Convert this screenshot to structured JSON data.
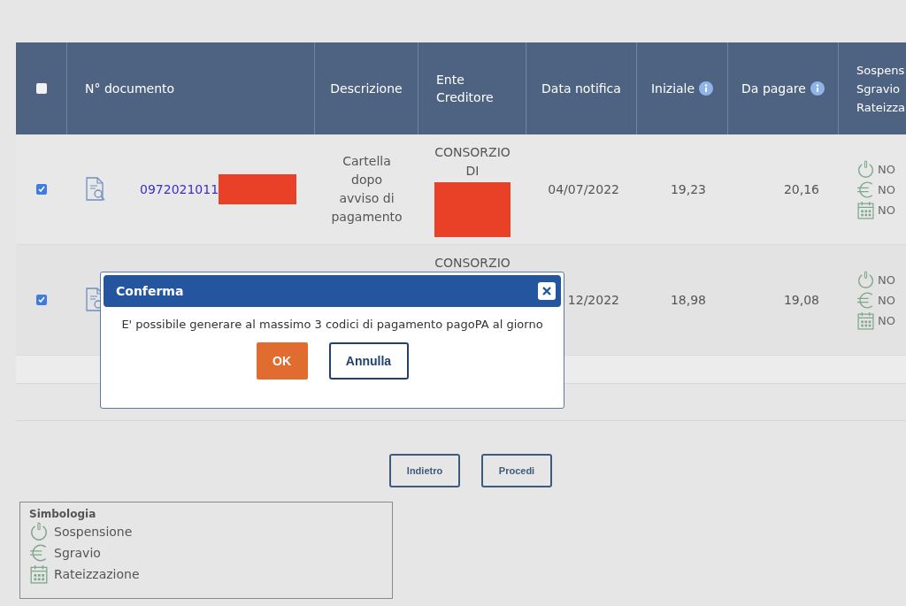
{
  "table": {
    "header_checkbox": {
      "checked": false
    },
    "columns": [
      {
        "label": "N° documento"
      },
      {
        "label": "Descrizione"
      },
      {
        "label": "Ente Creditore"
      },
      {
        "label": "Data notifica"
      },
      {
        "label": "Iniziale",
        "info": true
      },
      {
        "label": "Da pagare",
        "info": true
      }
    ],
    "last_column_lines": [
      "Sospens",
      "Sgravio",
      "Rateizza"
    ],
    "rows": [
      {
        "checked": true,
        "document": "0972021011",
        "document_redacted": true,
        "description": "Cartella dopo avviso di pagamento",
        "creditor": [
          "CONSORZIO",
          "DI"
        ],
        "creditor_redacted": true,
        "date": "04/07/2022",
        "initial": "19,23",
        "to_pay": "20,16",
        "status": [
          {
            "kind": "sospensione",
            "value": "NO"
          },
          {
            "kind": "sgravio",
            "value": "NO"
          },
          {
            "kind": "rateizzazione",
            "value": "NO"
          }
        ]
      },
      {
        "checked": true,
        "creditor": [
          "CONSORZIO"
        ],
        "date": "12/2022",
        "initial": "18,98",
        "to_pay": "19,08",
        "status": [
          {
            "kind": "sospensione",
            "value": "NO"
          },
          {
            "kind": "sgravio",
            "value": "NO"
          },
          {
            "kind": "rateizzazione",
            "value": "NO"
          }
        ]
      }
    ]
  },
  "buttons": [
    "Indietro",
    "Procedi"
  ],
  "legend": {
    "title": "Simbologia",
    "items": [
      {
        "kind": "sospensione",
        "label": "Sospensione"
      },
      {
        "kind": "sgravio",
        "label": "Sgravio"
      },
      {
        "kind": "rateizzazione",
        "label": "Rateizzazione"
      }
    ]
  },
  "dialog": {
    "title": "Conferma",
    "message": "E' possibile generare al massimo 3 codici di pagamento pagoPA al giorno",
    "ok": "OK",
    "cancel": "Annulla"
  }
}
